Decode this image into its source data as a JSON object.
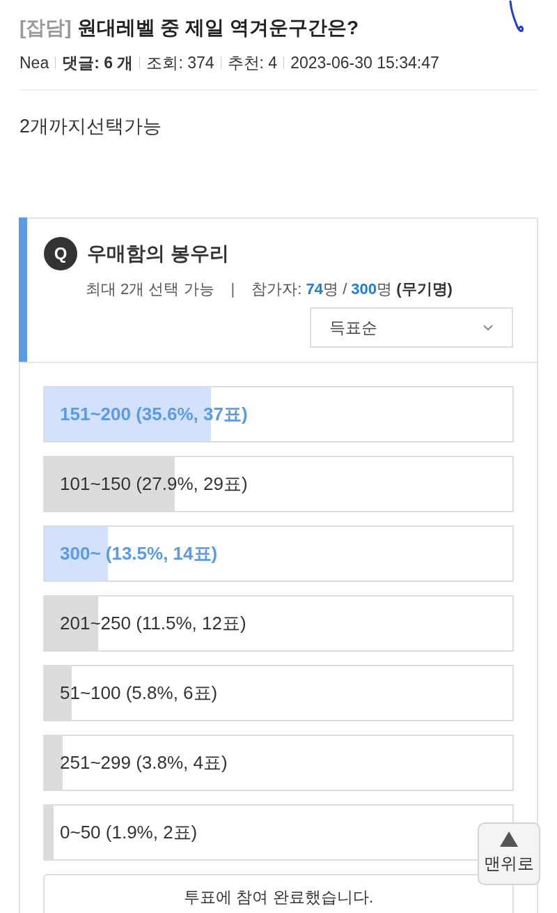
{
  "post": {
    "category": "[잡담]",
    "title": "원대레벨 중 제일 역겨운구간은?",
    "meta": [
      {
        "kind": "plain",
        "text": "Nea"
      },
      {
        "kind": "bold",
        "text": "댓글: 6 개"
      },
      {
        "kind": "plain",
        "text": "조회: 374"
      },
      {
        "kind": "plain",
        "text": "추천: 4"
      },
      {
        "kind": "plain",
        "text": "2023-06-30 15:34:47"
      }
    ],
    "body": "2개까지선택가능"
  },
  "poll": {
    "badge": "Q",
    "question": "우매함의 봉우리",
    "limit": "최대 2개 선택 가능",
    "separator": "|",
    "participants": "참가자: **74**명 / **300**명 *(무기명)*",
    "sort": "득표순",
    "options": [
      {
        "label": "151~200 (35.6%, 37표)",
        "level": 0.356,
        "selected": true
      },
      {
        "label": "101~150 (27.9%, 29표)",
        "level": 0.279,
        "selected": false
      },
      {
        "label": "300~ (13.5%, 14표)",
        "level": 0.135,
        "selected": true
      },
      {
        "label": "201~250 (11.5%, 12표)",
        "level": 0.115,
        "selected": false
      },
      {
        "label": "51~100 (5.8%, 6표)",
        "level": 0.058,
        "selected": false
      },
      {
        "label": "251~299 (3.8%, 4표)",
        "level": 0.038,
        "selected": false
      },
      {
        "label": "0~50 (1.9%, 2표)",
        "level": 0.019,
        "selected": false
      }
    ],
    "status": "투표에 참여 완료했습니다."
  },
  "top_button": "맨위로"
}
